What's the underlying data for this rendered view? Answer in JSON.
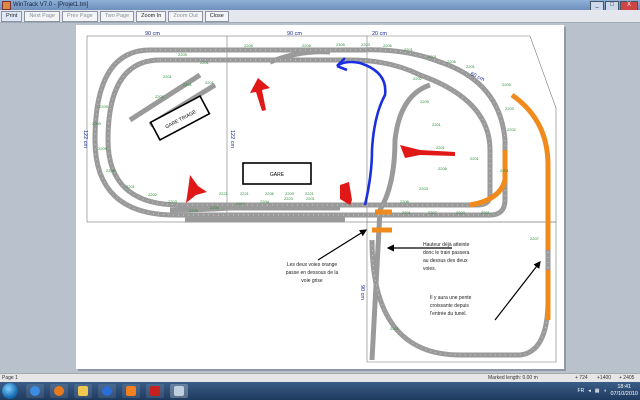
{
  "window": {
    "title": "WinTrack  V7.0 - [Projet1.tm]",
    "minimize": "_",
    "maximize": "□",
    "close": "X"
  },
  "toolbar": {
    "print": "Print",
    "next_page": "Next Page",
    "prev_page": "Prev Page",
    "two_page": "Two Page",
    "zoom_in": "Zoom In",
    "zoom_out": "Zoom Out",
    "close": "Close"
  },
  "drawing": {
    "dims": {
      "d90_left": "90 cm",
      "d90_mid": "90 cm",
      "d20": "20 cm",
      "d122_left": "122 cm",
      "d122_mid": "122 cm",
      "d60": "60 cm",
      "d90_bottom": "90 cm"
    },
    "stations": {
      "triage": "GARE TRIAGE",
      "gare": "GARE"
    },
    "notes": {
      "left": [
        "Les deux voies orange",
        "passe en dessous de la",
        "voie grise"
      ],
      "right_top": [
        "Hauteur déjà atteinte",
        "donc le train passera",
        "au dessus des deux",
        "voies."
      ],
      "right_bottom": [
        "Il y aura une pente",
        "croissante depuis",
        "l'entrée du tunel."
      ]
    },
    "track_codes": [
      "2205",
      "2208",
      "2206",
      "2305",
      "2203",
      "2206",
      "2201",
      "2201",
      "2206",
      "2201",
      "2205",
      "2202",
      "2209",
      "2201",
      "2201",
      "2206",
      "2203",
      "2206",
      "2201",
      "2307",
      "2203",
      "2201",
      "2201",
      "2201",
      "2201",
      "2201",
      "2203",
      "2209",
      "2209",
      "2209",
      "2206",
      "2201",
      "2202",
      "2203",
      "2205",
      "2206",
      "2207",
      "2204",
      "2223",
      "2201",
      "2221",
      "2221",
      "2206",
      "2209",
      "2221",
      "2201",
      "2203",
      "2202",
      "2201",
      "2207",
      "2201"
    ]
  },
  "status": {
    "page": "Page 1",
    "marked_length": "Marked length:  0.00 m",
    "coord_a": "+ 724",
    "coord_b": "+1400",
    "coord_c": "+ 2405"
  },
  "tray": {
    "lang": "FR",
    "time": "18:41",
    "date": "07/10/2010"
  },
  "colors": {
    "track": "#a9a9a9",
    "orange_track": "#f08a1c",
    "red_arrow": "#e01818",
    "blue_arrow": "#1a2fe0"
  }
}
